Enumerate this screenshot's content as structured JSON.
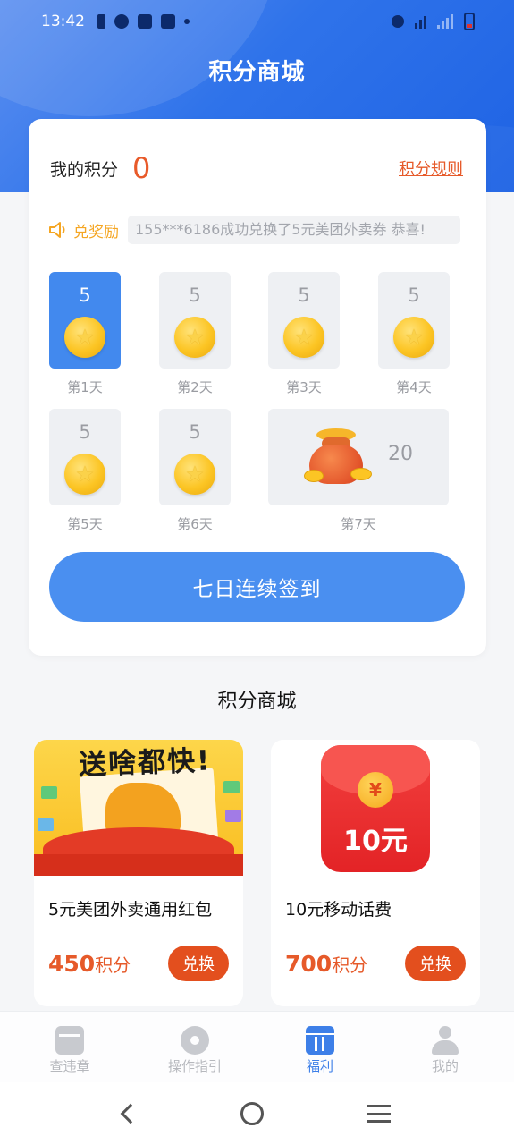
{
  "status_bar": {
    "time": "13:42"
  },
  "header": {
    "title": "积分商城"
  },
  "points": {
    "label": "我的积分",
    "value": "0",
    "rules_link": "积分规则"
  },
  "ticker": {
    "label": "兑奖励",
    "message": "155***6186成功兑换了5元美团外卖券 恭喜!"
  },
  "checkin": {
    "days": [
      {
        "points": "5",
        "label": "第1天",
        "active": true
      },
      {
        "points": "5",
        "label": "第2天",
        "active": false
      },
      {
        "points": "5",
        "label": "第3天",
        "active": false
      },
      {
        "points": "5",
        "label": "第4天",
        "active": false
      },
      {
        "points": "5",
        "label": "第5天",
        "active": false
      },
      {
        "points": "5",
        "label": "第6天",
        "active": false
      },
      {
        "points": "20",
        "label": "第7天",
        "active": false
      }
    ],
    "button_label": "七日连续签到"
  },
  "mall": {
    "title": "积分商城",
    "products": [
      {
        "image_banner": "送啥都快!",
        "name": "5元美团外卖通用红包",
        "price_number": "450",
        "price_unit": "积分",
        "button_label": "兑换"
      },
      {
        "image_coin": "¥",
        "image_amount": "10元",
        "name": "10元移动话费",
        "price_number": "700",
        "price_unit": "积分",
        "button_label": "兑换"
      }
    ]
  },
  "tabbar": {
    "items": [
      {
        "label": "查违章",
        "icon": "car-icon",
        "active": false
      },
      {
        "label": "操作指引",
        "icon": "disc-icon",
        "active": false
      },
      {
        "label": "福利",
        "icon": "gift-icon",
        "active": true
      },
      {
        "label": "我的",
        "icon": "user-icon",
        "active": false
      }
    ]
  },
  "colors": {
    "primary": "#4a8ff0",
    "accent": "#e65a2a",
    "ticker": "#f5a623"
  }
}
